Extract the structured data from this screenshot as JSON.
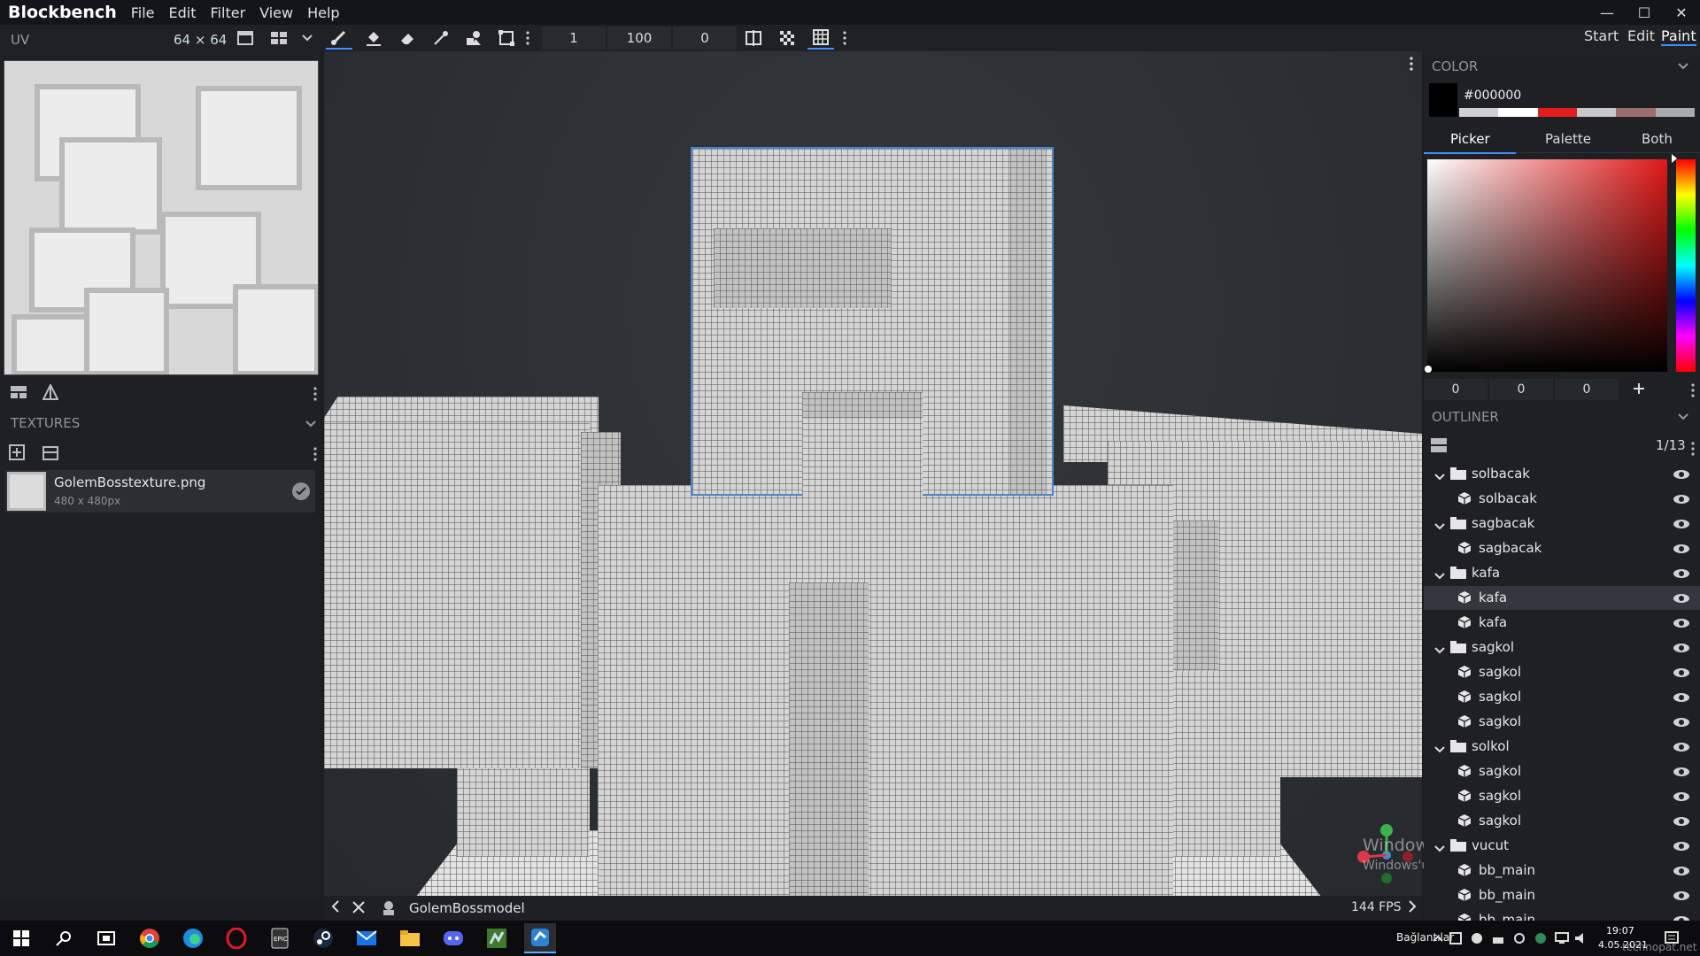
{
  "app": {
    "name": "Blockbench"
  },
  "menu": [
    "File",
    "Edit",
    "Filter",
    "View",
    "Help"
  ],
  "toolbar": {
    "uv_label": "UV",
    "uv_size": "64 ⨯ 64",
    "brush_size": "1",
    "opacity": "100",
    "softness": "0"
  },
  "modes": [
    "Start",
    "Edit",
    "Paint"
  ],
  "textures": {
    "title": "TEXTURES",
    "file": "GolemBosstexture.png",
    "dims": "480 x 480px"
  },
  "color": {
    "title": "COLOR",
    "hex": "#000000",
    "tabs": [
      "Picker",
      "Palette",
      "Both"
    ],
    "r": "0",
    "g": "0",
    "b": "0",
    "current": "#000000",
    "palette_colors": [
      "#d0d0d0",
      "#ffffff",
      "#e11e1e",
      "#c8c8c8",
      "#9a6e6e",
      "#aaaaaa"
    ]
  },
  "outliner": {
    "title": "OUTLINER",
    "count": "1/13",
    "items": [
      {
        "type": "group",
        "label": "solbacak",
        "indent": 0
      },
      {
        "type": "cube",
        "label": "solbacak",
        "indent": 1
      },
      {
        "type": "group",
        "label": "sagbacak",
        "indent": 0
      },
      {
        "type": "cube",
        "label": "sagbacak",
        "indent": 1
      },
      {
        "type": "group",
        "label": "kafa",
        "indent": 0
      },
      {
        "type": "cube",
        "label": "kafa",
        "indent": 1,
        "selected": true
      },
      {
        "type": "cube",
        "label": "kafa",
        "indent": 1
      },
      {
        "type": "group",
        "label": "sagkol",
        "indent": 0
      },
      {
        "type": "cube",
        "label": "sagkol",
        "indent": 1
      },
      {
        "type": "cube",
        "label": "sagkol",
        "indent": 1
      },
      {
        "type": "cube",
        "label": "sagkol",
        "indent": 1
      },
      {
        "type": "group",
        "label": "solkol",
        "indent": 0
      },
      {
        "type": "cube",
        "label": "sagkol",
        "indent": 1
      },
      {
        "type": "cube",
        "label": "sagkol",
        "indent": 1
      },
      {
        "type": "cube",
        "label": "sagkol",
        "indent": 1
      },
      {
        "type": "group",
        "label": "vucut",
        "indent": 0
      },
      {
        "type": "cube",
        "label": "bb_main",
        "indent": 1
      },
      {
        "type": "cube",
        "label": "bb_main",
        "indent": 1
      },
      {
        "type": "cube",
        "label": "bb_main",
        "indent": 1
      }
    ]
  },
  "statusbar": {
    "model": "GolemBossmodel",
    "fps": "144 FPS"
  },
  "watermark": {
    "line1": "Windows'u Etkinleştir",
    "line2": "Windows'u etkinleştirmek için Ayarlar'a gidin."
  },
  "taskbar": {
    "connections": "Bağlantılar",
    "time": "19:07",
    "date": "4.05.2021",
    "site": "technopat.net"
  }
}
